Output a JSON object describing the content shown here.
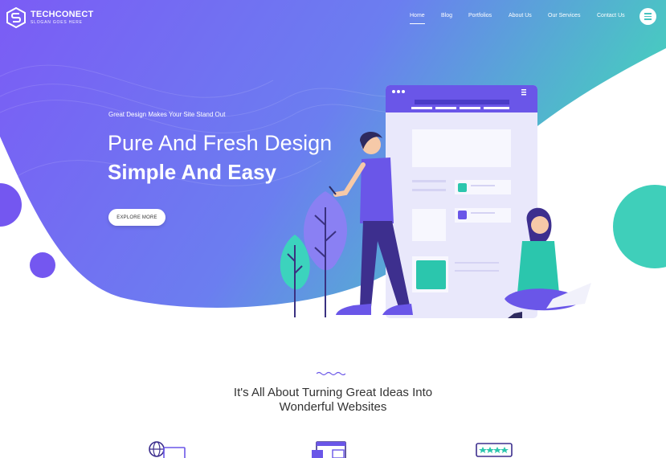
{
  "brand": {
    "name": "TECHCONECT",
    "slogan": "SLOGAN GOES HERE"
  },
  "nav": {
    "items": [
      {
        "label": "Home",
        "active": true
      },
      {
        "label": "Blog",
        "active": false
      },
      {
        "label": "Portfolios",
        "active": false
      },
      {
        "label": "About Us",
        "active": false
      },
      {
        "label": "Our Services",
        "active": false
      },
      {
        "label": "Contact Us",
        "active": false
      }
    ],
    "menu_icon": "hamburger-icon"
  },
  "hero": {
    "tagline": "Great Design Makes Your Site Stand Out",
    "headline": "Pure And Fresh Design",
    "subheadline": "Simple And Easy",
    "cta_label": "EXPLORE MORE"
  },
  "section": {
    "title_line1": "It's All About Turning Great Ideas Into",
    "title_line2": "Wonderful Websites"
  },
  "features": [
    {
      "icon": "globe-browser-icon"
    },
    {
      "icon": "web-layout-icon"
    },
    {
      "icon": "rating-stars-icon"
    }
  ],
  "colors": {
    "gradient_start": "#6c63f5",
    "gradient_end": "#4ccdbe",
    "accent_teal": "#36c9b4",
    "accent_purple": "#6a5cf0"
  }
}
